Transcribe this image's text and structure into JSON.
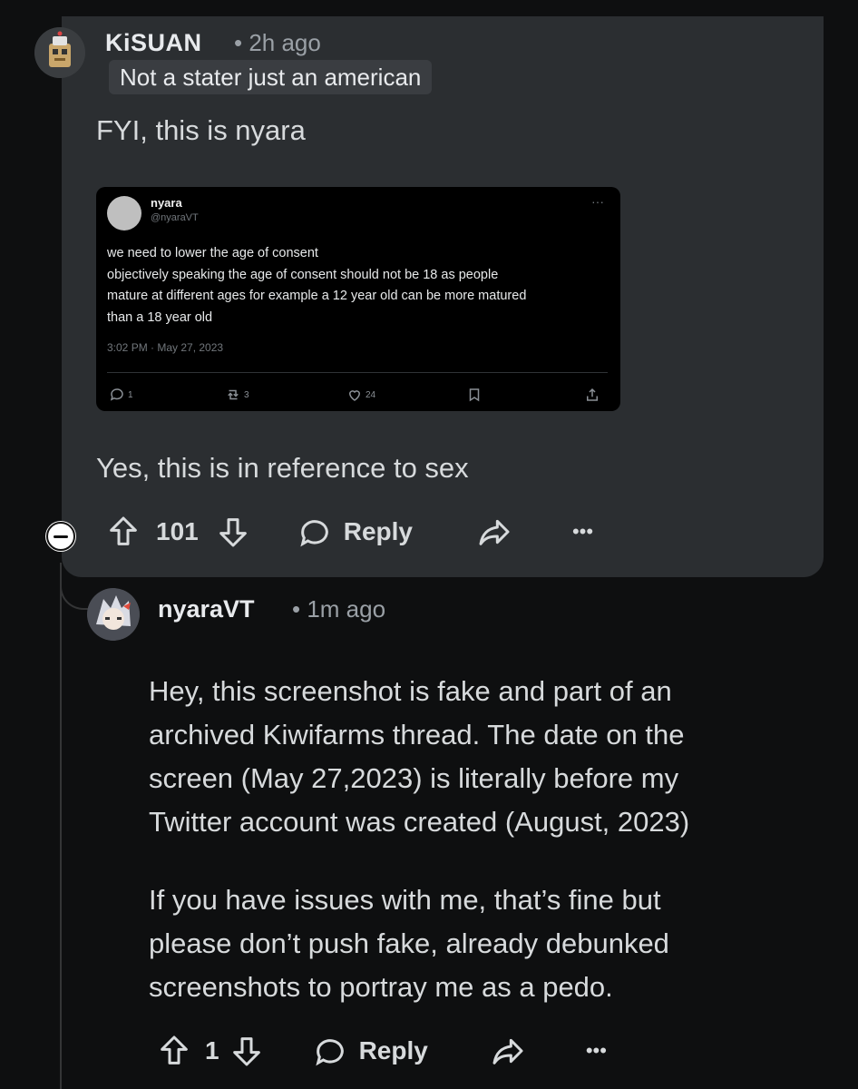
{
  "comment1": {
    "username": "KiSUAN",
    "time": "• 2h ago",
    "flair": "Not a stater just an american",
    "text_top": "FYI, this is nyara",
    "text_bottom": "Yes, this is in reference to sex",
    "vote_count": "101",
    "reply_label": "Reply",
    "more_label": "•••"
  },
  "embedded_tweet": {
    "name": "nyara",
    "handle": "@nyaraVT",
    "more": "···",
    "lines": [
      "we need to lower the age of consent",
      "objectively speaking the age of consent should not be 18 as people",
      "mature at different ages for example a 12 year old can be more matured",
      "than a 18 year old"
    ],
    "timestamp": "3:02 PM · May 27, 2023",
    "replies": "1",
    "retweets": "3",
    "likes": "24"
  },
  "comment2": {
    "username": "nyaraVT",
    "time": "• 1m ago",
    "para1_lines": [
      "Hey, this screenshot is fake and part of an",
      "archived Kiwifarms thread. The date on the",
      "screen (May 27,2023) is literally before my",
      "Twitter account was created (August, 2023)"
    ],
    "para2_lines": [
      "If you have issues with me, that’s fine but",
      "please don’t push fake, already debunked",
      "screenshots to portray me as a pedo."
    ],
    "vote_count": "1",
    "reply_label": "Reply",
    "more_label": "•••"
  },
  "icons": [
    "collapse-icon",
    "upvote-icon",
    "downvote-icon",
    "comment-bubble-icon",
    "share-icon",
    "more-icon",
    "bookmark-icon",
    "retweet-icon",
    "heart-icon"
  ]
}
